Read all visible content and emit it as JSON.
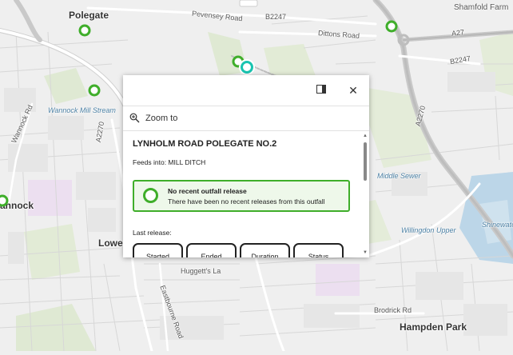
{
  "map": {
    "places": [
      {
        "text": "Polegate",
        "cls": "place-big"
      },
      {
        "text": "Lower",
        "cls": "place-big"
      },
      {
        "text": "annock",
        "cls": "place-big"
      },
      {
        "text": "Hampden Park",
        "cls": "place-big"
      },
      {
        "text": "Shamfold Farm",
        "cls": ""
      },
      {
        "text": "Willingdon Upper",
        "cls": "water-label"
      },
      {
        "text": "Wannock Mill Stream",
        "cls": "water-label"
      },
      {
        "text": "Middle Sewer",
        "cls": "water-label"
      },
      {
        "text": "Shinewater",
        "cls": "water-label"
      }
    ],
    "roads": [
      "Pevensey Road",
      "B2247",
      "Dittons Road",
      "A27",
      "B2247",
      "Wannock Rd",
      "A2270",
      "Huggett's La",
      "Eastbourne Road",
      "Brodrick Rd",
      "A2270"
    ]
  },
  "popup": {
    "zoom_label": "Zoom to",
    "close_glyph": "✕",
    "title": "LYNHOLM ROAD POLEGATE NO.2",
    "feeds_into": "Feeds into: MILL DITCH",
    "status_title": "No recent outfall release",
    "status_text": "There have been no recent releases from this outfall",
    "last_release_label": "Last release:",
    "buttons": {
      "started": "Started",
      "ended": "Ended",
      "duration": "Duration",
      "status": "Status"
    }
  },
  "colors": {
    "marker_green": "#3fae2a",
    "selected_teal": "#19c4b0",
    "status_bg": "#eef8ea"
  }
}
